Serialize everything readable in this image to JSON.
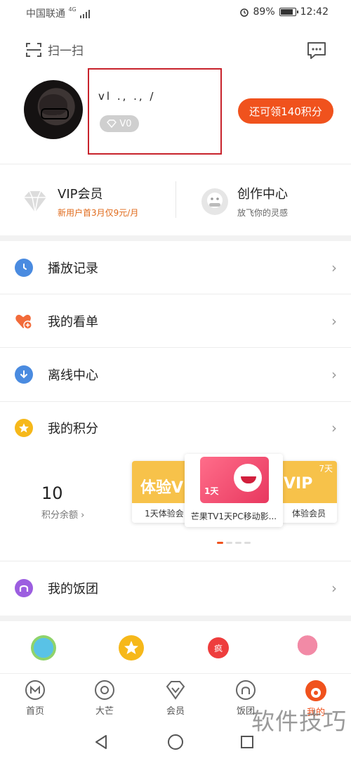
{
  "status": {
    "carrier": "中国联通",
    "network": "4G",
    "battery": "89%",
    "battery_level": 0.89,
    "time": "12:42"
  },
  "header": {
    "scan_label": "扫一扫"
  },
  "profile": {
    "username": "vl ., ., /",
    "level": "V0",
    "points_button": "还可领140积分"
  },
  "vip": {
    "title": "VIP会员",
    "subtitle": "新用户首3月仅9元/月"
  },
  "create": {
    "title": "创作中心",
    "subtitle": "放飞你的灵感"
  },
  "menu": [
    {
      "label": "播放记录"
    },
    {
      "label": "我的看单"
    },
    {
      "label": "离线中心"
    },
    {
      "label": "我的积分"
    },
    {
      "label": "我的饭团"
    }
  ],
  "points": {
    "value": "10",
    "label": "积分余额",
    "cards": [
      {
        "caption": "1天体验会",
        "badge": "体验V"
      },
      {
        "caption": "芒果TV1天PC移动影...",
        "badge": "1天"
      },
      {
        "caption": "体验会员",
        "badge": "VIP",
        "corner": "7天"
      }
    ]
  },
  "nav": [
    {
      "label": "首页"
    },
    {
      "label": "大芒"
    },
    {
      "label": "会员"
    },
    {
      "label": "饭团"
    },
    {
      "label": "我的"
    }
  ],
  "colors": {
    "accent": "#f0521d",
    "highlight_box": "#c8232c"
  },
  "watermark": "软件技巧"
}
